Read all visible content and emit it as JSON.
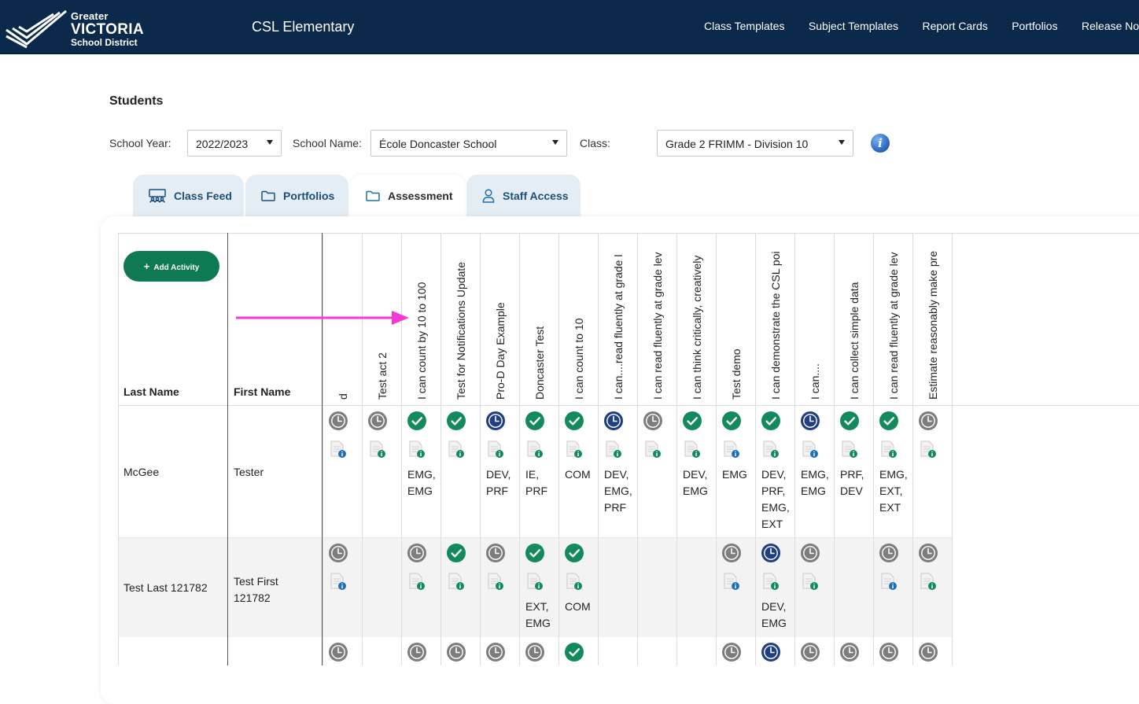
{
  "header": {
    "logo": {
      "line1": "Greater",
      "line2": "VICTORIA",
      "line3": "School District"
    },
    "app_title": "CSL Elementary",
    "nav": [
      "Class Templates",
      "Subject Templates",
      "Report Cards",
      "Portfolios",
      "Release No"
    ]
  },
  "page": {
    "title": "Students",
    "filters": {
      "school_year_label": "School Year:",
      "school_year_value": "2022/2023",
      "school_name_label": "School Name:",
      "school_name_value": "École Doncaster School",
      "class_label": "Class:",
      "class_value": "Grade 2 FRIMM - Division 10",
      "info_glyph": "i"
    },
    "tabs": [
      {
        "label": "Class Feed",
        "icon": "class-feed-icon"
      },
      {
        "label": "Portfolios",
        "icon": "folder-icon"
      },
      {
        "label": "Assessment",
        "icon": "folder-icon"
      },
      {
        "label": "Staff Access",
        "icon": "person-icon"
      }
    ],
    "active_tab": "Assessment"
  },
  "table": {
    "add_activity": "Add Activity",
    "columns": {
      "last_name": "Last Name",
      "first_name": "First Name"
    },
    "activities": [
      "d",
      "Test act 2",
      "I can count by 10 to 100",
      "Test for Notifications Update",
      "Pro-D Day Example",
      "Doncaster Test",
      "I can count to 10",
      "I can....read fluently at grade l",
      "I can read fluently at grade lev",
      "I can think critically, creatively",
      "Test demo",
      "I can demonstrate the CSL poi",
      "I can....",
      "I can collect simple data",
      "I can read fluently at grade lev",
      "Estimate reasonably make pre"
    ],
    "rows": [
      {
        "last": "McGee",
        "first": "Tester",
        "status": [
          "pending",
          "pending",
          "done",
          "done",
          "scheduled",
          "done",
          "done",
          "scheduled",
          "pending",
          "done",
          "done",
          "done",
          "scheduled",
          "done",
          "done",
          "pending"
        ],
        "docs": [
          "blue",
          "green",
          "green",
          "green",
          "green",
          "green",
          "green",
          "green",
          "green",
          "green",
          "blue",
          "green",
          "blue",
          "green",
          "green",
          "green"
        ],
        "grades": [
          "",
          "",
          "EMG, EMG",
          "",
          "DEV, PRF",
          "IE, PRF",
          "COM",
          "DEV, EMG, PRF",
          "",
          "DEV, EMG",
          "EMG",
          "DEV, PRF, EMG, EXT",
          "EMG, EMG",
          "PRF, DEV",
          "EMG, EXT, EXT",
          ""
        ]
      },
      {
        "last": "Test Last 121782",
        "first": "Test First 121782",
        "status": [
          "pending",
          "",
          "pending",
          "done",
          "pending",
          "done",
          "done",
          "",
          "",
          "",
          "pending",
          "scheduled",
          "pending",
          "",
          "pending",
          "pending"
        ],
        "docs": [
          "blue",
          "",
          "green",
          "green",
          "green",
          "green",
          "green",
          "",
          "",
          "",
          "blue",
          "green",
          "green",
          "",
          "blue",
          "green"
        ],
        "grades": [
          "",
          "",
          "",
          "",
          "",
          "EXT, EMG",
          "COM",
          "",
          "",
          "",
          "",
          "DEV, EMG",
          "",
          "",
          "",
          ""
        ]
      },
      {
        "last": "",
        "first": "",
        "status": [
          "pending",
          "",
          "pending",
          "pending",
          "pending",
          "pending",
          "done",
          "",
          "",
          "",
          "pending",
          "scheduled",
          "pending",
          "pending",
          "pending",
          "pending"
        ],
        "docs": [],
        "grades": []
      }
    ]
  },
  "colors": {
    "header_bg": "#0b2a4b",
    "done": "#128a5b",
    "pending": "#7d7d7d",
    "scheduled": "#1f3f82",
    "annotation_arrow": "#f23ad6"
  }
}
